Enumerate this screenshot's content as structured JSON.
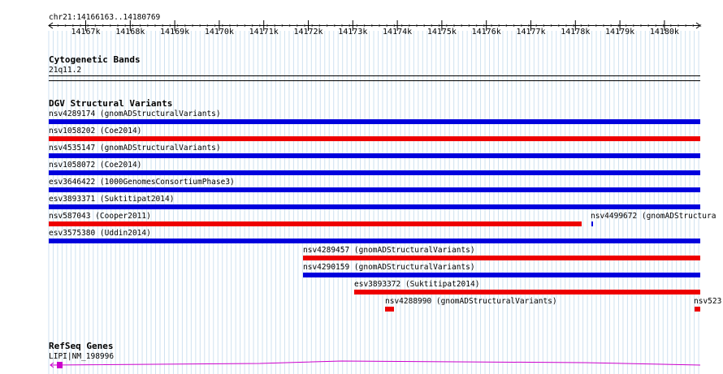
{
  "ruler": {
    "coords": "chr21:14166163..14180769",
    "tick_labels": [
      "14167k",
      "14168k",
      "14169k",
      "14170k",
      "14171k",
      "14172k",
      "14173k",
      "14174k",
      "14175k",
      "14176k",
      "14177k",
      "14178k",
      "14179k",
      "14180k"
    ]
  },
  "cytobands": {
    "title": "Cytogenetic Bands",
    "band": "21q11.2"
  },
  "dgv": {
    "title": "DGV Structural Variants",
    "items": [
      {
        "label": "nsv4289174 (gnomADStructuralVariants)",
        "color": "#0000dd"
      },
      {
        "label": "nsv1058202 (Coe2014)",
        "color": "#ee0000"
      },
      {
        "label": "nsv4535147 (gnomADStructuralVariants)",
        "color": "#0000dd"
      },
      {
        "label": "nsv1058072 (Coe2014)",
        "color": "#0000dd"
      },
      {
        "label": "esv3646422 (1000GenomesConsortiumPhase3)",
        "color": "#0000dd"
      },
      {
        "label": "esv3893371 (Suktitipat2014)",
        "color": "#0000dd"
      },
      {
        "label": "nsv587043 (Cooper2011)",
        "color": "#ee0000"
      },
      {
        "label": "nsv4499672 (gnomADStructura",
        "color": "#0000dd"
      },
      {
        "label": "esv3575380 (Uddin2014)",
        "color": "#0000dd"
      },
      {
        "label": "nsv4289457 (gnomADStructuralVariants)",
        "color": "#ee0000"
      },
      {
        "label": "nsv4290159 (gnomADStructuralVariants)",
        "color": "#0000dd"
      },
      {
        "label": "esv3893372 (Suktitipat2014)",
        "color": "#ee0000"
      },
      {
        "label": "nsv4288990 (gnomADStructuralVariants)",
        "color": "#ee0000"
      },
      {
        "label": "nsv523",
        "color": "#ee0000"
      }
    ]
  },
  "refseq": {
    "title": "RefSeq Genes",
    "gene": "LIPI|NM_198996",
    "color": "#cc00cc"
  }
}
